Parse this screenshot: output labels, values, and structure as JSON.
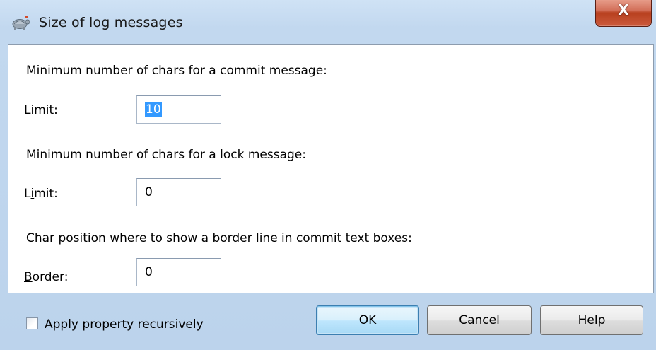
{
  "window": {
    "title": "Size of log messages",
    "close_glyph": "X",
    "icon": "tortoise-app-icon"
  },
  "commit_section": {
    "heading": "Minimum number of chars for a commit message:",
    "label_first": "L",
    "label_ul": "i",
    "label_rest": "mit:",
    "value": "10"
  },
  "lock_section": {
    "heading": "Minimum number of chars for a lock message:",
    "label_first": "L",
    "label_ul": "i",
    "label_rest": "mit:",
    "value": "0"
  },
  "border_section": {
    "heading": "Char position where to show a border line in commit text boxes:",
    "label_ul": "B",
    "label_rest": "order:",
    "value": "0"
  },
  "footer": {
    "recursive_label": "Apply property recursively",
    "recursive_checked": false,
    "ok_label": "OK",
    "cancel_label": "Cancel",
    "help_label": "Help"
  }
}
